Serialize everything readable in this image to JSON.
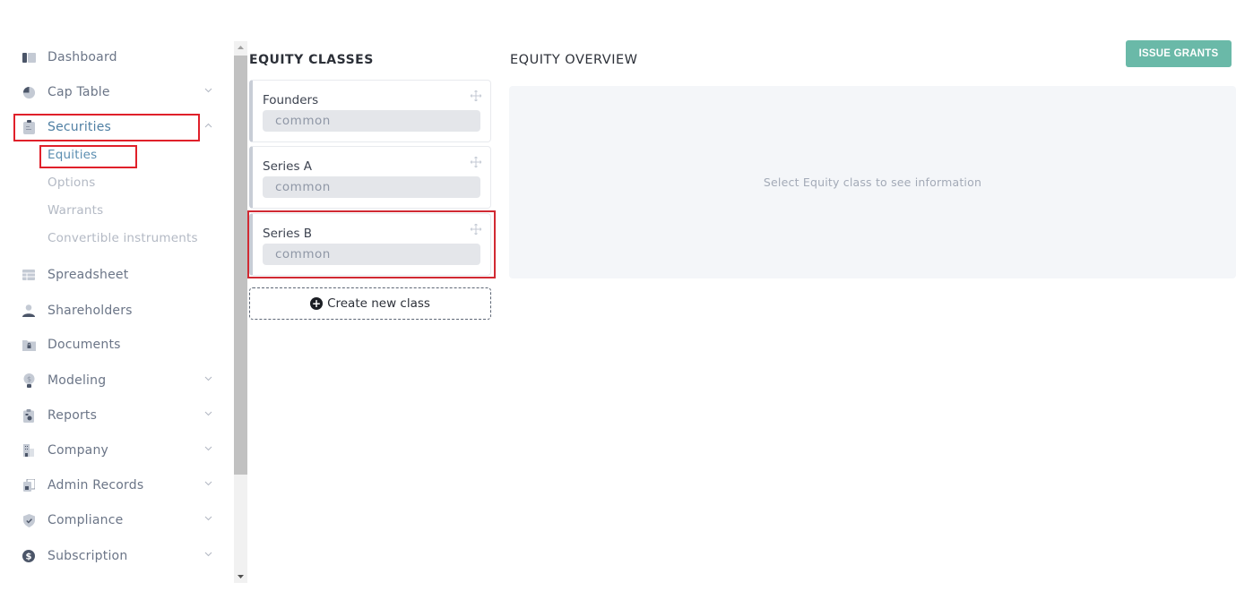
{
  "sidebar": {
    "items": [
      {
        "label": "Dashboard",
        "icon": "dashboard-icon",
        "expandable": false
      },
      {
        "label": "Cap Table",
        "icon": "pie-chart-icon",
        "expandable": true,
        "expanded": false
      },
      {
        "label": "Securities",
        "icon": "clipboard-icon",
        "expandable": true,
        "expanded": true,
        "active": true
      },
      {
        "label": "Spreadsheet",
        "icon": "table-icon",
        "expandable": false
      },
      {
        "label": "Shareholders",
        "icon": "user-icon",
        "expandable": false
      },
      {
        "label": "Documents",
        "icon": "folder-lock-icon",
        "expandable": false
      },
      {
        "label": "Modeling",
        "icon": "lightbulb-dollar-icon",
        "expandable": true,
        "expanded": false
      },
      {
        "label": "Reports",
        "icon": "report-icon",
        "expandable": true,
        "expanded": false
      },
      {
        "label": "Company",
        "icon": "building-icon",
        "expandable": true,
        "expanded": false
      },
      {
        "label": "Admin Records",
        "icon": "records-icon",
        "expandable": true,
        "expanded": false
      },
      {
        "label": "Compliance",
        "icon": "shield-check-icon",
        "expandable": true,
        "expanded": false
      },
      {
        "label": "Subscription",
        "icon": "dollar-circle-icon",
        "expandable": true,
        "expanded": false
      }
    ],
    "securities_subitems": [
      {
        "label": "Equities",
        "active": true
      },
      {
        "label": "Options"
      },
      {
        "label": "Warrants"
      },
      {
        "label": "Convertible instruments"
      }
    ]
  },
  "equity_classes": {
    "title": "EQUITY CLASSES",
    "classes": [
      {
        "name": "Founders",
        "type": "common"
      },
      {
        "name": "Series A",
        "type": "common"
      },
      {
        "name": "Series B",
        "type": "common",
        "highlighted": true
      }
    ],
    "create_label": "Create new class"
  },
  "overview": {
    "title": "EQUITY OVERVIEW",
    "empty_message": "Select Equity class to see information",
    "issue_button": "ISSUE GRANTS"
  },
  "colors": {
    "accent": "#6ab9a8",
    "active_link": "#5a8db0",
    "highlight": "#e0202a"
  }
}
